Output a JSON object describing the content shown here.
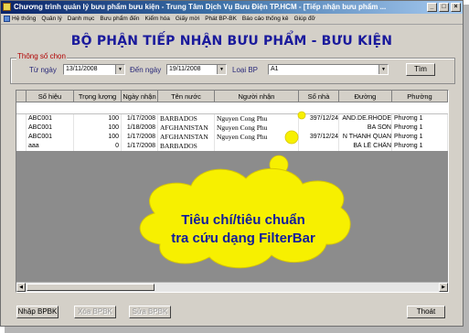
{
  "window": {
    "title": "Chương trình quản lý bưu phẩm bưu kiện - Trung Tâm Dịch Vụ Bưu Điện TP.HCM - [Tiếp nhận bưu phẩm ...",
    "min": "_",
    "max": "□",
    "close": "×"
  },
  "menu": [
    "Hệ thống",
    "Quản lý",
    "Danh mục",
    "Bưu phẩm đến",
    "Kiểm hóa",
    "Giấy mời",
    "Phát BP-BK",
    "Báo cáo thống kê",
    "Giúp đỡ"
  ],
  "heading": "BỘ PHẬN TIẾP NHẬN BƯU PHẨM - BƯU KIỆN",
  "filters": {
    "group_title": "Thông số chọn",
    "from_label": "Từ ngày",
    "from_value": "13/11/2008",
    "to_label": "Đến ngày",
    "to_value": "19/11/2008",
    "type_label": "Loại BP",
    "type_value": "A1",
    "search_button": "Tìm"
  },
  "grid": {
    "columns": [
      "Số hiệu",
      "Trọng lượng",
      "Ngày nhận",
      "Tên nước",
      "Người nhận",
      "Số nhà",
      "Đường",
      "Phường"
    ],
    "rows": [
      [
        "ABC001",
        "100",
        "1/17/2008",
        "BARBADOS",
        "Nguyen Cong Phu",
        "397/12/24",
        "AND.DE.RHODE",
        "Phương 1"
      ],
      [
        "ABC001",
        "100",
        "1/18/2008",
        "AFGHANISTAN",
        "Nguyen Cong Phu",
        "",
        "BA SON",
        "Phương 1"
      ],
      [
        "ABC001",
        "100",
        "1/17/2008",
        "AFGHANISTAN",
        "Nguyen Cong Phu",
        "397/12/24",
        "N THANH QUAN",
        "Phương 1"
      ],
      [
        "aaa",
        "0",
        "1/17/2008",
        "BARBADOS",
        "",
        "",
        "BÀ LÊ CHÂN",
        "Phương 1"
      ]
    ]
  },
  "callout": {
    "line1": "Tiêu chí/tiêu chuẩn",
    "line2": "tra cứu dạng FilterBar"
  },
  "buttons": {
    "import": "Nhập BPBK",
    "delete": "Xóa BPBK",
    "edit": "Sửa BPBK",
    "exit": "Thoát"
  },
  "colors": {
    "heading": "#1a1a9c",
    "callout_fill": "#f7f000",
    "callout_text": "#111c9c"
  }
}
